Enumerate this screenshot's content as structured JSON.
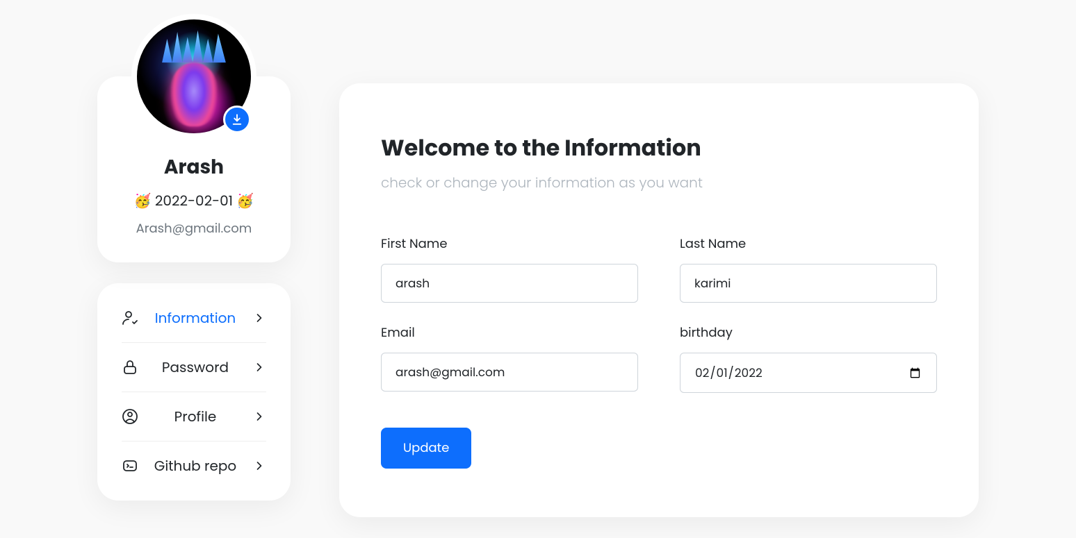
{
  "profile": {
    "name": "Arash",
    "date_line": "🥳 2022-02-01 🥳",
    "email": "Arash@gmail.com"
  },
  "nav": {
    "items": [
      {
        "label": "Information",
        "active": true
      },
      {
        "label": "Password",
        "active": false
      },
      {
        "label": "Profile",
        "active": false
      },
      {
        "label": "Github repo",
        "active": false
      }
    ]
  },
  "main": {
    "title": "Welcome to the Information",
    "subtitle": "check or change your information as you want",
    "fields": {
      "first_name": {
        "label": "First Name",
        "value": "arash"
      },
      "last_name": {
        "label": "Last Name",
        "value": "karimi"
      },
      "email": {
        "label": "Email",
        "value": "arash@gmail.com"
      },
      "birthday": {
        "label": "birthday",
        "value": "2022-02-01"
      }
    },
    "update_label": "Update"
  }
}
